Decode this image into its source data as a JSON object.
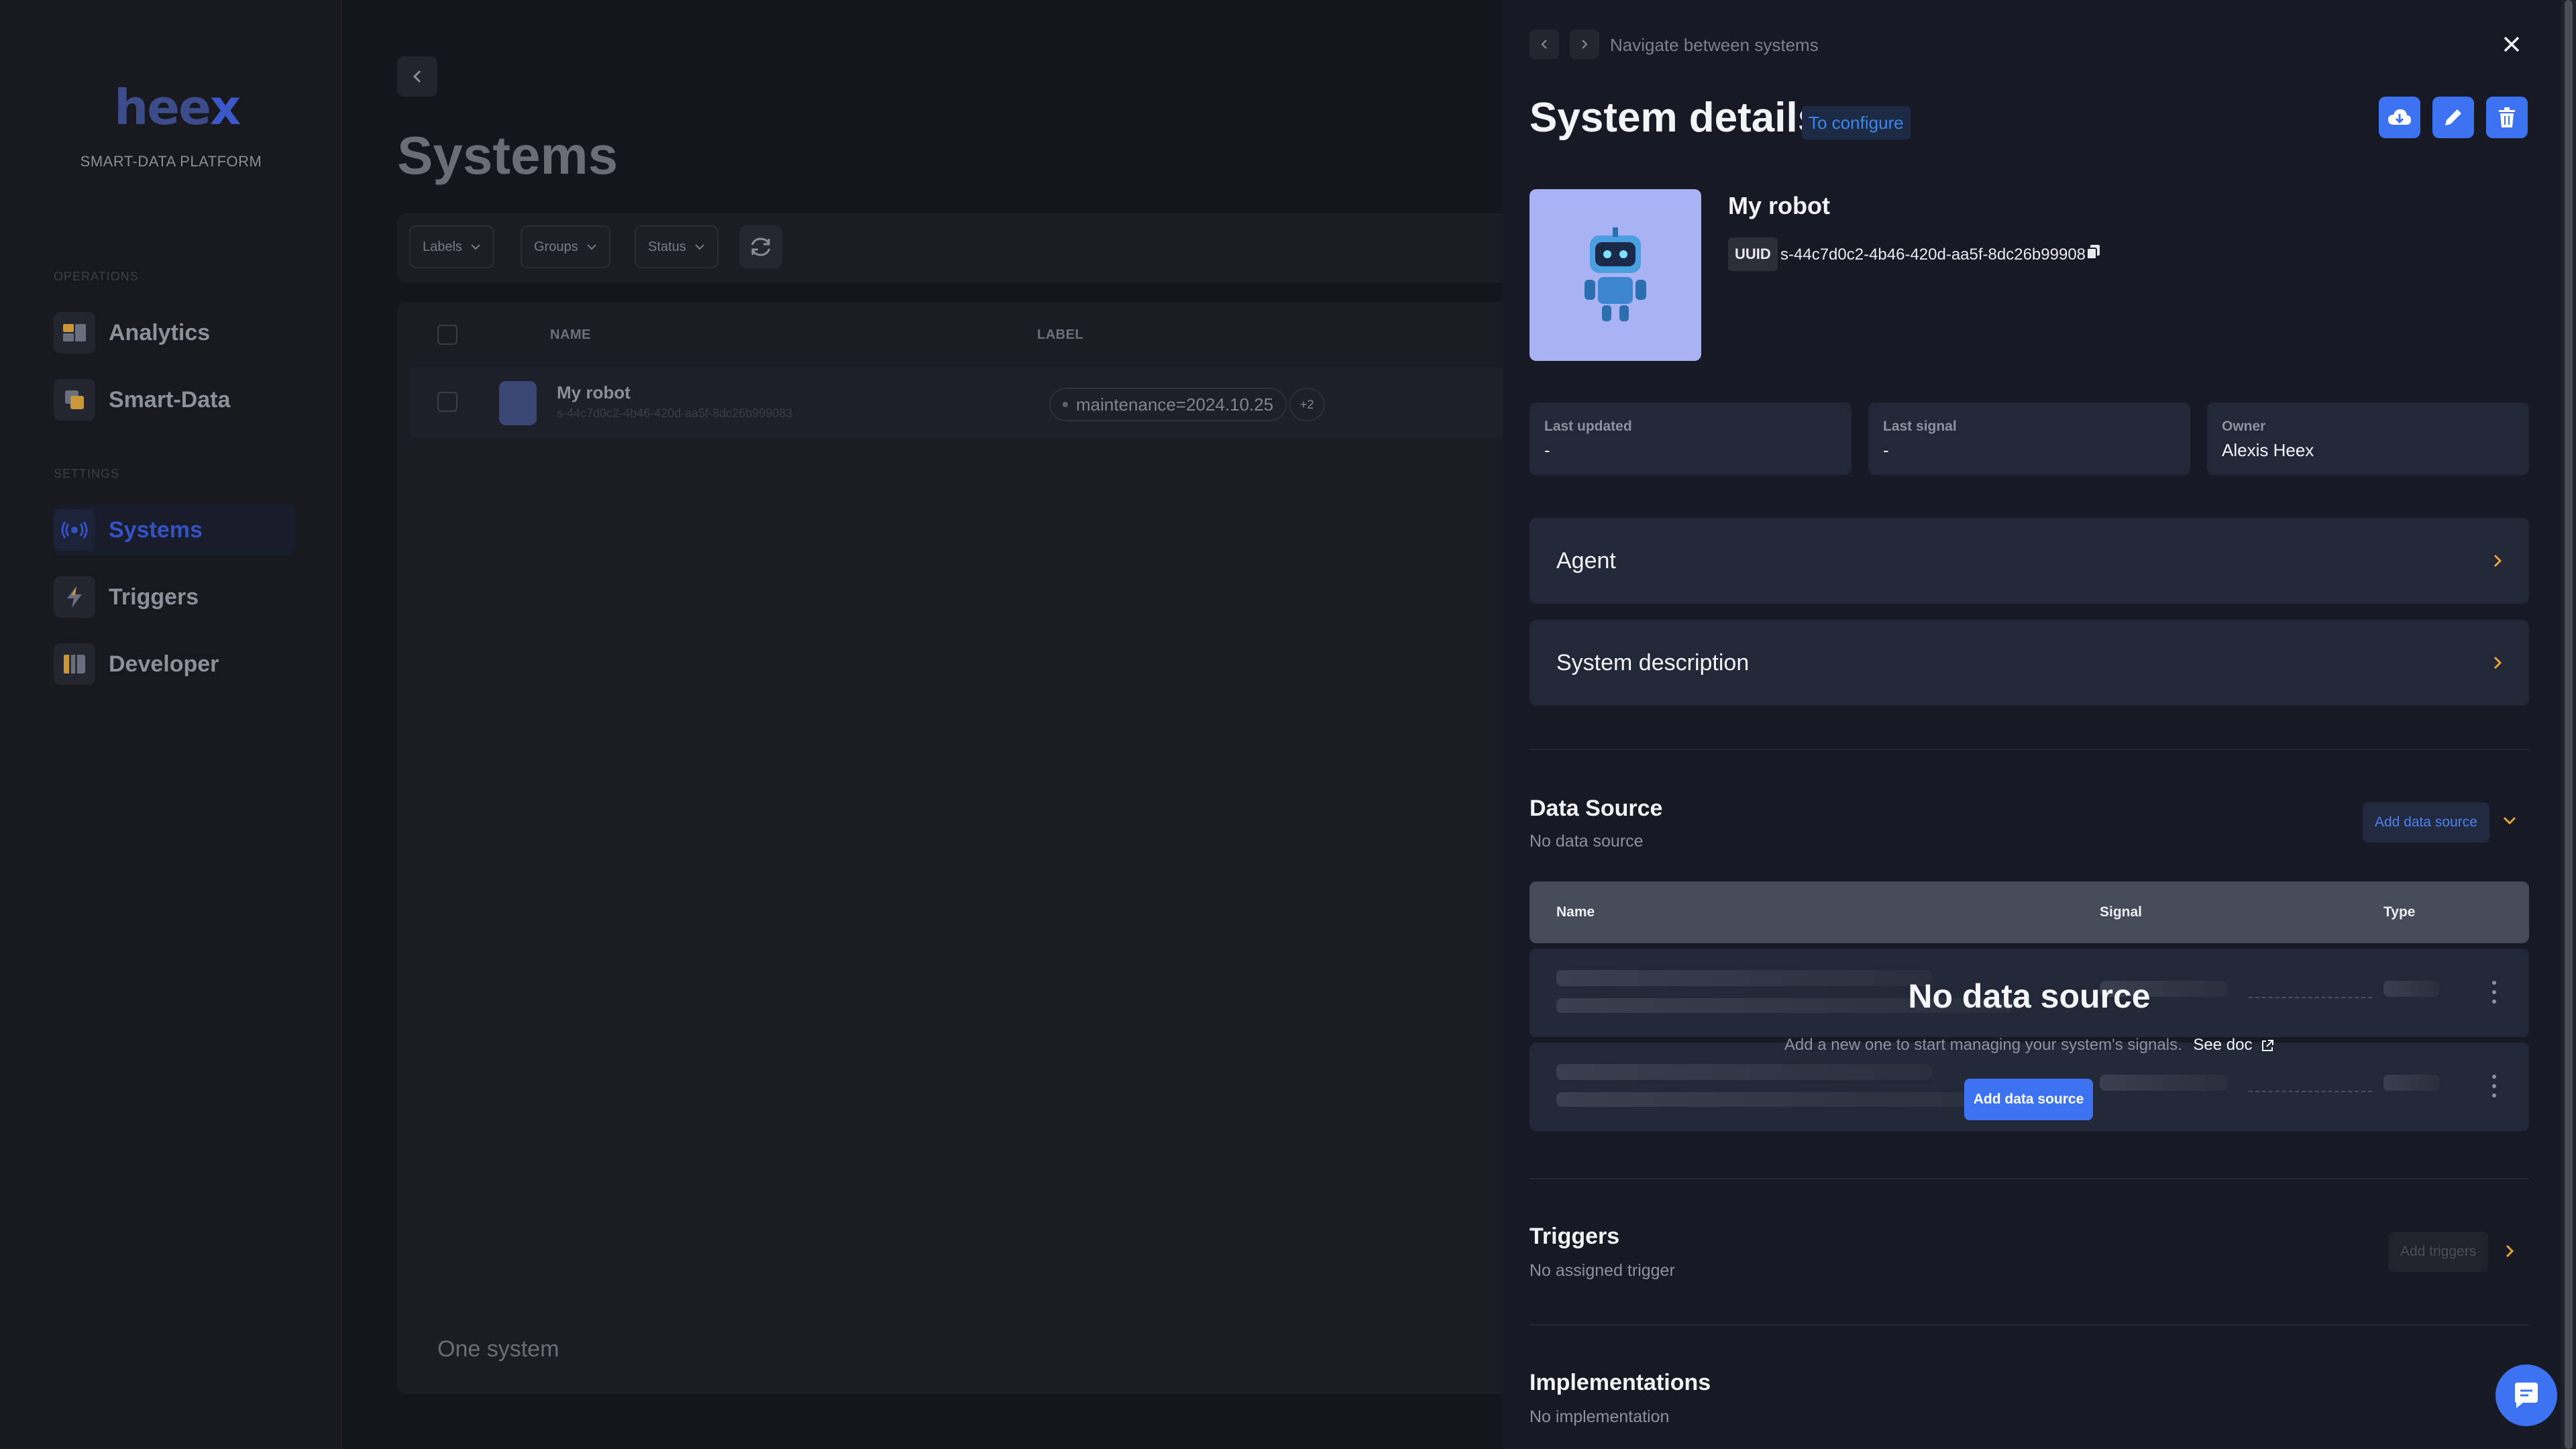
{
  "app": {
    "logo_text": "hee",
    "logo_accent": "x",
    "platform_name": "SMART-DATA PLATFORM",
    "accent_color": "#3d73f0"
  },
  "sidebar": {
    "operations_label": "OPERATIONS",
    "settings_label": "SETTINGS",
    "items": [
      {
        "label": "Analytics",
        "icon": "analytics-icon"
      },
      {
        "label": "Smart-Data",
        "icon": "smart-data-icon"
      },
      {
        "label": "Systems",
        "icon": "systems-icon",
        "active": true
      },
      {
        "label": "Triggers",
        "icon": "triggers-icon"
      },
      {
        "label": "Developer",
        "icon": "developer-icon"
      }
    ]
  },
  "main": {
    "title": "Systems",
    "filters": [
      "Labels",
      "Groups",
      "Status"
    ],
    "table": {
      "columns": [
        "NAME",
        "LABEL"
      ],
      "rows": [
        {
          "name": "My robot",
          "uuid": "s-44c7d0c2-4b46-420d-aa5f-8dc26b999083",
          "label": "maintenance=2024.10.25",
          "more": "+2"
        }
      ]
    },
    "footer_count": "One system"
  },
  "drawer": {
    "nav_hint": "Navigate between systems",
    "title": "System details",
    "status": "To configure",
    "system": {
      "name": "My robot",
      "uuid_label": "UUID",
      "uuid": "s-44c7d0c2-4b46-420d-aa5f-8dc26b999083"
    },
    "info": [
      {
        "key": "Last updated",
        "value": "-"
      },
      {
        "key": "Last signal",
        "value": "-"
      },
      {
        "key": "Owner",
        "value": "Alexis Heex"
      }
    ],
    "sections": {
      "agent": "Agent",
      "description": "System description"
    },
    "data_source": {
      "title": "Data Source",
      "subtitle": "No data source",
      "add_label": "Add data source",
      "columns": [
        "Name",
        "Signal",
        "Type"
      ],
      "empty_title": "No data source",
      "empty_text": "Add a new one to start managing your system's signals.",
      "doc_link": "See doc",
      "empty_button": "Add data source"
    },
    "triggers": {
      "title": "Triggers",
      "subtitle": "No assigned trigger",
      "add_label": "Add triggers"
    },
    "implementations": {
      "title": "Implementations",
      "subtitle": "No implementation"
    }
  }
}
